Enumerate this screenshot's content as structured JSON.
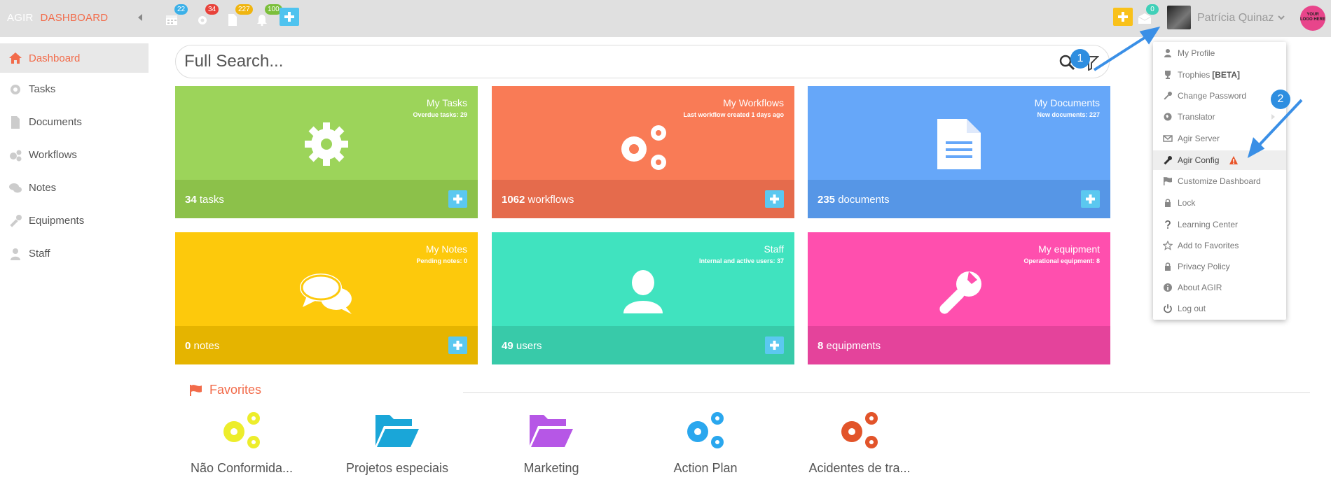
{
  "brand": {
    "name": "AGIR",
    "section": "DASHBOARD"
  },
  "topbar": {
    "calendar_badge": "22",
    "gears_badge": "34",
    "documents_badge": "227",
    "bell_badge": "100",
    "messages_badge": "0",
    "user_name": "Patrícia Quinaz",
    "logo_text": "YOUR LOGO HERE"
  },
  "sidebar": {
    "items": [
      {
        "label": "Dashboard"
      },
      {
        "label": "Tasks"
      },
      {
        "label": "Documents"
      },
      {
        "label": "Workflows"
      },
      {
        "label": "Notes"
      },
      {
        "label": "Equipments"
      },
      {
        "label": "Staff"
      }
    ]
  },
  "search": {
    "placeholder": "Full Search..."
  },
  "tiles": [
    {
      "title": "My Tasks",
      "subtitle": "Overdue tasks: 29",
      "count": "34",
      "unit": "tasks",
      "color": "#9cd45a",
      "foot": "#8cc14a"
    },
    {
      "title": "My Workflows",
      "subtitle": "Last workflow created 1 days ago",
      "count": "1062",
      "unit": "workflows",
      "color": "#f97b56",
      "foot": "#e56b4c"
    },
    {
      "title": "My Documents",
      "subtitle": "New documents: 227",
      "count": "235",
      "unit": "documents",
      "color": "#66a7f9",
      "foot": "#5696e6"
    },
    {
      "title": "My Notes",
      "subtitle": "Pending notes: 0",
      "count": "0",
      "unit": "notes",
      "color": "#fdc90c",
      "foot": "#e5b400"
    },
    {
      "title": "Staff",
      "subtitle": "Internal and active users: 37",
      "count": "49",
      "unit": "users",
      "color": "#40e3bf",
      "foot": "#38caa9"
    },
    {
      "title": "My equipment",
      "subtitle": "Operational equipment: 8",
      "count": "8",
      "unit": "equipments",
      "color": "#ff4fae",
      "foot": "#e4439b"
    }
  ],
  "favorites": {
    "title": "Favorites",
    "items": [
      {
        "label": "Não Conformida...",
        "icon": "gears-icon",
        "color": "#eded2b"
      },
      {
        "label": "Projetos especiais",
        "icon": "folder-open-icon",
        "color": "#1aa6d8"
      },
      {
        "label": "Marketing",
        "icon": "folder-open-icon",
        "color": "#b657e6"
      },
      {
        "label": "Action Plan",
        "icon": "gears-icon",
        "color": "#2aa7ee"
      },
      {
        "label": "Acidentes de tra...",
        "icon": "gears-icon",
        "color": "#e2542a"
      }
    ]
  },
  "user_menu": {
    "items": [
      {
        "label": "My Profile"
      },
      {
        "label": "Trophies",
        "tag": "[BETA]"
      },
      {
        "label": "Change Password"
      },
      {
        "label": "Translator"
      },
      {
        "label": "Agir Server"
      },
      {
        "label": "Agir Config"
      },
      {
        "label": "Customize Dashboard"
      },
      {
        "label": "Lock"
      },
      {
        "label": "Learning Center"
      },
      {
        "label": "Add to Favorites"
      },
      {
        "label": "Privacy Policy"
      },
      {
        "label": "About AGIR"
      },
      {
        "label": "Log out"
      }
    ]
  },
  "callouts": {
    "first": "1",
    "second": "2"
  },
  "colors": {
    "accent": "#f26b4a",
    "add_button": "#5bc8f0",
    "callout": "#2e8ee0"
  }
}
